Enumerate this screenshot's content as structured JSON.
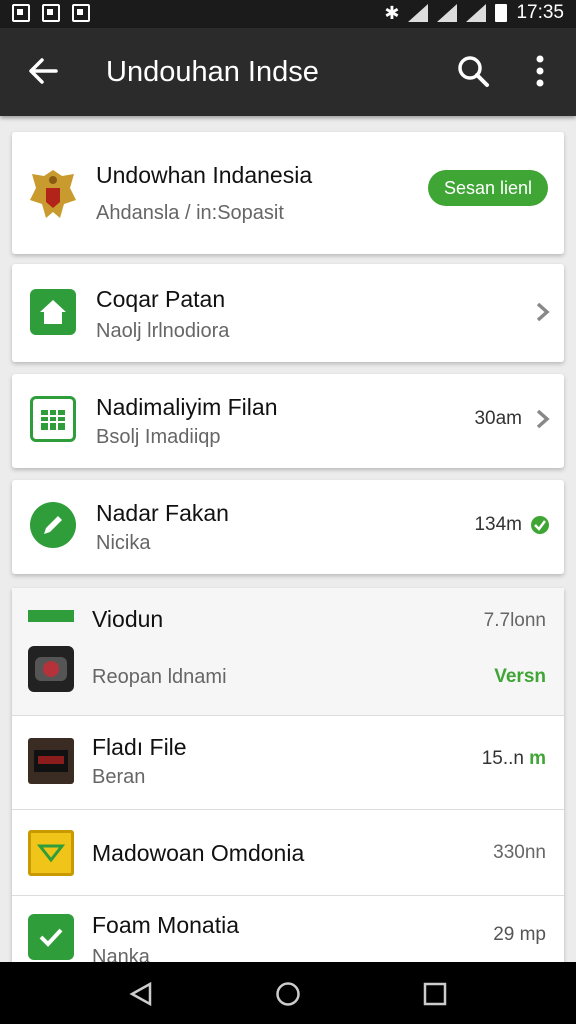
{
  "status_bar": {
    "time": "17:35"
  },
  "app_bar": {
    "title": "Undouhan Indse"
  },
  "header_card": {
    "title": "Undowhan Indanesia",
    "subtitle": "Ahdansla / in:Sopasit",
    "action_label": "Sesan lienl"
  },
  "cards": [
    {
      "title": "Coqar Patan",
      "subtitle": "Naolj lrlnodiora",
      "meta": "",
      "trailing": "chevron",
      "icon": "home-icon",
      "color": "#2e9d3a"
    },
    {
      "title": "Nadimaliyim Filan",
      "subtitle": "Bsolj Imadiiqp",
      "meta": "30am",
      "trailing": "chevron",
      "icon": "sheet-icon",
      "color": "#2e9d3a"
    },
    {
      "title": "Nadar Fakan",
      "subtitle": "Nicika",
      "meta": "134m",
      "trailing": "check",
      "icon": "edit-icon",
      "color": "#2e9d3a"
    }
  ],
  "list": [
    {
      "title": "Viodun",
      "meta": "7.7lonn",
      "subtitle": "Reopan ldnami",
      "action": "Versn",
      "icon": "phone-icon"
    },
    {
      "title": "Fladı File",
      "subtitle": "Beran",
      "meta": "15..n",
      "badge": "m",
      "icon": "tv-icon"
    },
    {
      "title": "Madowoan Omdonia",
      "subtitle": "",
      "meta": "330nn",
      "icon": "folder-icon"
    },
    {
      "title": "Foam Monatia",
      "subtitle": "Nanka",
      "meta": "29 mp",
      "icon": "check-icon"
    }
  ],
  "colors": {
    "accent": "#3fa535",
    "appbar": "#2b2b2b",
    "statusbar": "#1b1b1b"
  }
}
